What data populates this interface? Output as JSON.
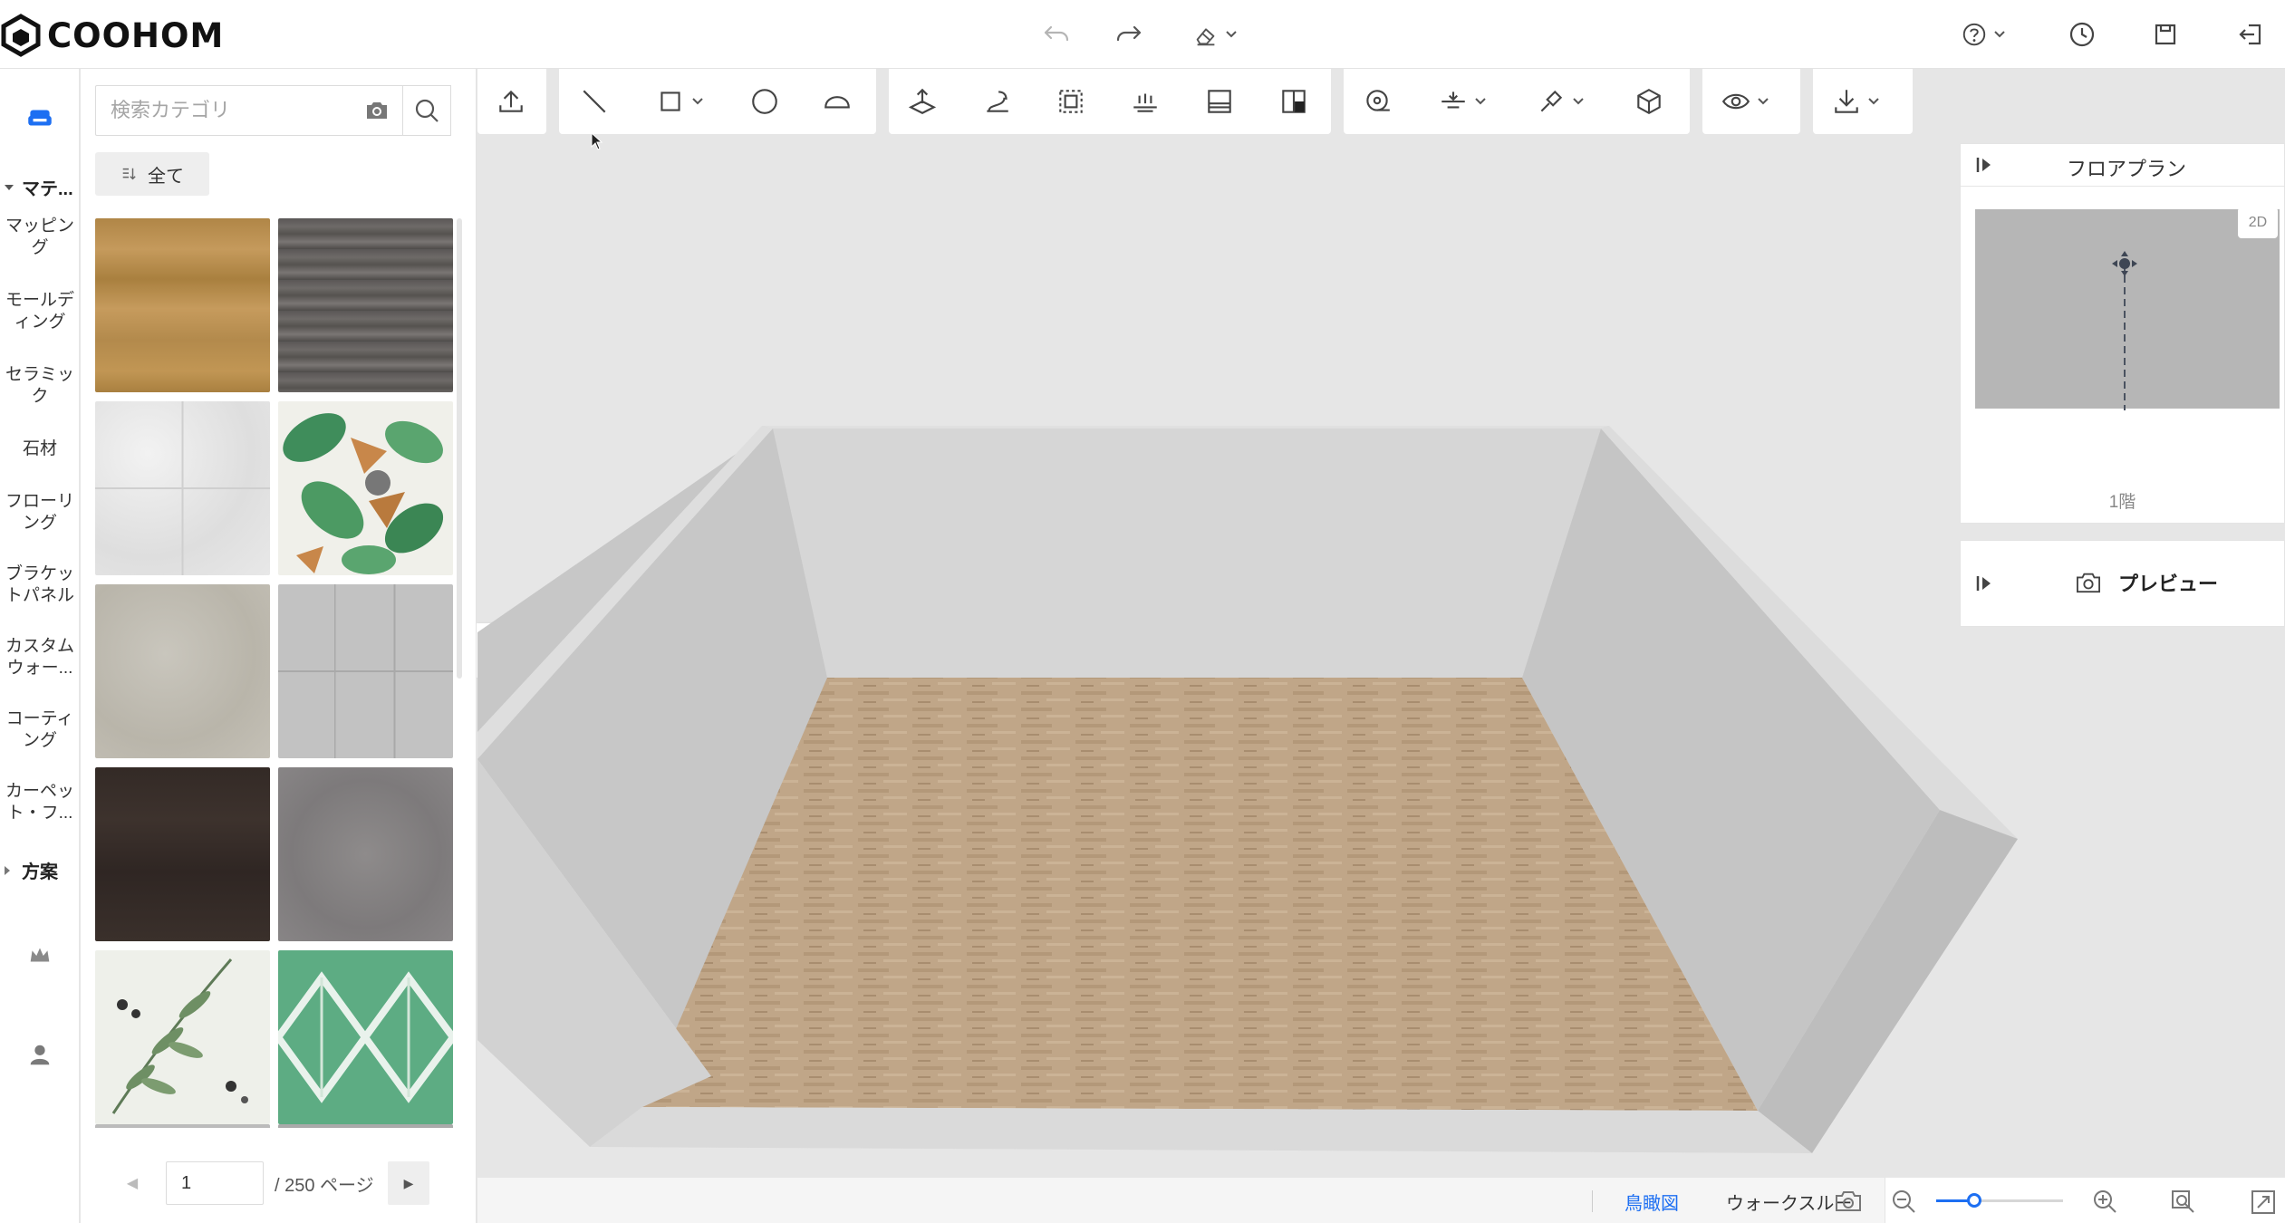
{
  "app": {
    "logo_text": "COOHOM"
  },
  "search": {
    "placeholder": "検索カテゴリ"
  },
  "filter": {
    "label": "全て"
  },
  "sidebar": {
    "material_header": "マテ...",
    "scheme_header": "方案",
    "items": [
      {
        "label": "マッピング"
      },
      {
        "label": "モールディング"
      },
      {
        "label": "セラミック"
      },
      {
        "label": "石材"
      },
      {
        "label": "フローリング"
      },
      {
        "label": "ブラケットパネル"
      },
      {
        "label": "カスタムウォー..."
      },
      {
        "label": "コーティング"
      },
      {
        "label": "カーペット・フ..."
      }
    ]
  },
  "thumbnails": [
    {
      "name": "wood-oak"
    },
    {
      "name": "dark-grey-planks"
    },
    {
      "name": "white-marble"
    },
    {
      "name": "tropical-leaves"
    },
    {
      "name": "beige-stone"
    },
    {
      "name": "grey-tiles"
    },
    {
      "name": "dark-wood"
    },
    {
      "name": "grey-concrete"
    },
    {
      "name": "leaf-pattern"
    },
    {
      "name": "green-geometric"
    }
  ],
  "pagination": {
    "current": "1",
    "total": "/ 250 ページ"
  },
  "floorplan": {
    "title": "フロアプラン",
    "mode": "2D",
    "floor": "1階"
  },
  "preview": {
    "title": "プレビュー"
  },
  "view_modes": {
    "aerial": "鳥瞰図",
    "walkthrough": "ウォークスルー"
  },
  "zoom": {
    "level_fraction": 0.3
  },
  "colors": {
    "accent": "#1d6ff2",
    "floor": "#bfa587",
    "wall": "#cfcfcf"
  }
}
